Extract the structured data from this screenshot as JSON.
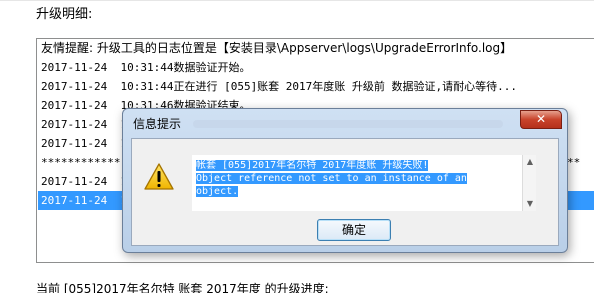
{
  "section_title": "升级明细:",
  "log": {
    "notice": "友情提醒: 升级工具的日志位置是【安装目录\\Appserver\\logs\\UpgradeErrorInfo.log】",
    "lines": [
      "2017-11-24  10:31:44数据验证开始。",
      "2017-11-24  10:31:44正在进行 [055]账套 2017年度账 升级前 数据验证,请耐心等待...",
      "2017-11-24  10:31:46数据验证结束。",
      "2017-11-24  10",
      "2017-11-24  10",
      "************",
      "2017-11-24  10",
      "2017-11-24  10"
    ],
    "stars_right": "**"
  },
  "dialog": {
    "title": "信息提示",
    "close_label": "✕",
    "message_lines": [
      " 帐套 [055]2017年名尔特 2017年度账 升级失败!",
      "Object reference not set to an instance of an",
      "object."
    ],
    "ok_label": "确定"
  },
  "progress_label": "当前 [055]2017年名尔特 账套 2017年度 的升级进度:"
}
